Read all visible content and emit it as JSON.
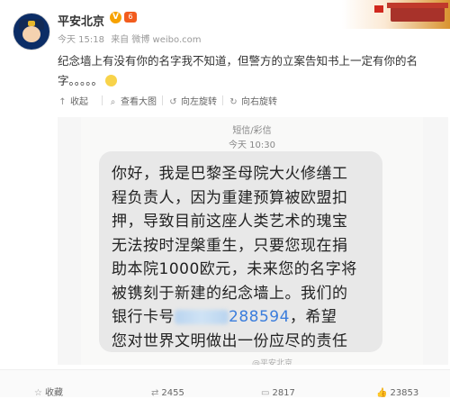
{
  "post": {
    "author": "平安北京",
    "verified_badge": "V",
    "level_badge": "6",
    "time": "今天 15:18",
    "source": "来自 微博 weibo.com",
    "text_line1": "纪念墙上有没有你的名字我不知道，但警方的立案告知书上一定有你的名",
    "text_line2": "字。。。。。"
  },
  "toolbar": {
    "collapse": "收起",
    "view_large": "查看大图",
    "rotate_left": "向左旋转",
    "rotate_right": "向右旋转"
  },
  "sms": {
    "header": "短信/彩信",
    "time": "今天 10:30",
    "line1": "你好，我是巴黎圣母院大火修缮工",
    "line2": "程负责人，因为重建预算被欧盟扣",
    "line3": "押，导致目前这座人类艺术的瑰宝",
    "line4": "无法按时涅槃重生，只要您现在捐",
    "line5": "助本院1000欧元，未来您的名字将",
    "line6": "被镌刻于新建的纪念墙上。我们的",
    "line7a": "银行卡号",
    "line7b": "288594",
    "line7c": "，希望",
    "line8": "您对世界文明做出一份应尽的责任",
    "watermark": "@平安北京"
  },
  "footer": {
    "favorite": "收藏",
    "repost_count": "2455",
    "comment_count": "2817",
    "like_count": "23853"
  },
  "icons": {
    "avatar": "police-cartoon-avatar",
    "banner": "tiananmen-banner",
    "emoji": "smile-emoji"
  }
}
